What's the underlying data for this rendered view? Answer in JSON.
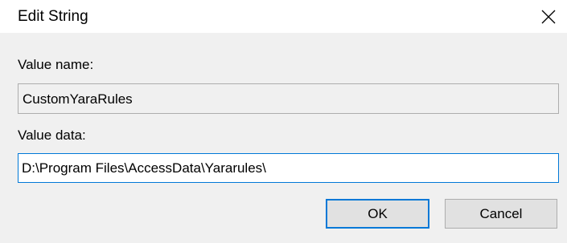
{
  "window": {
    "title": "Edit String",
    "close_icon": "close-icon"
  },
  "value_name": {
    "label": "Value name:",
    "value": "CustomYaraRules"
  },
  "value_data": {
    "label": "Value data:",
    "value": "D:\\Program Files\\AccessData\\Yararules\\"
  },
  "buttons": {
    "ok_label": "OK",
    "cancel_label": "Cancel"
  },
  "colors": {
    "focus_accent": "#0078d7",
    "dialog_background": "#f0f0f0",
    "titlebar_background": "#ffffff",
    "button_face": "#e1e1e1"
  }
}
